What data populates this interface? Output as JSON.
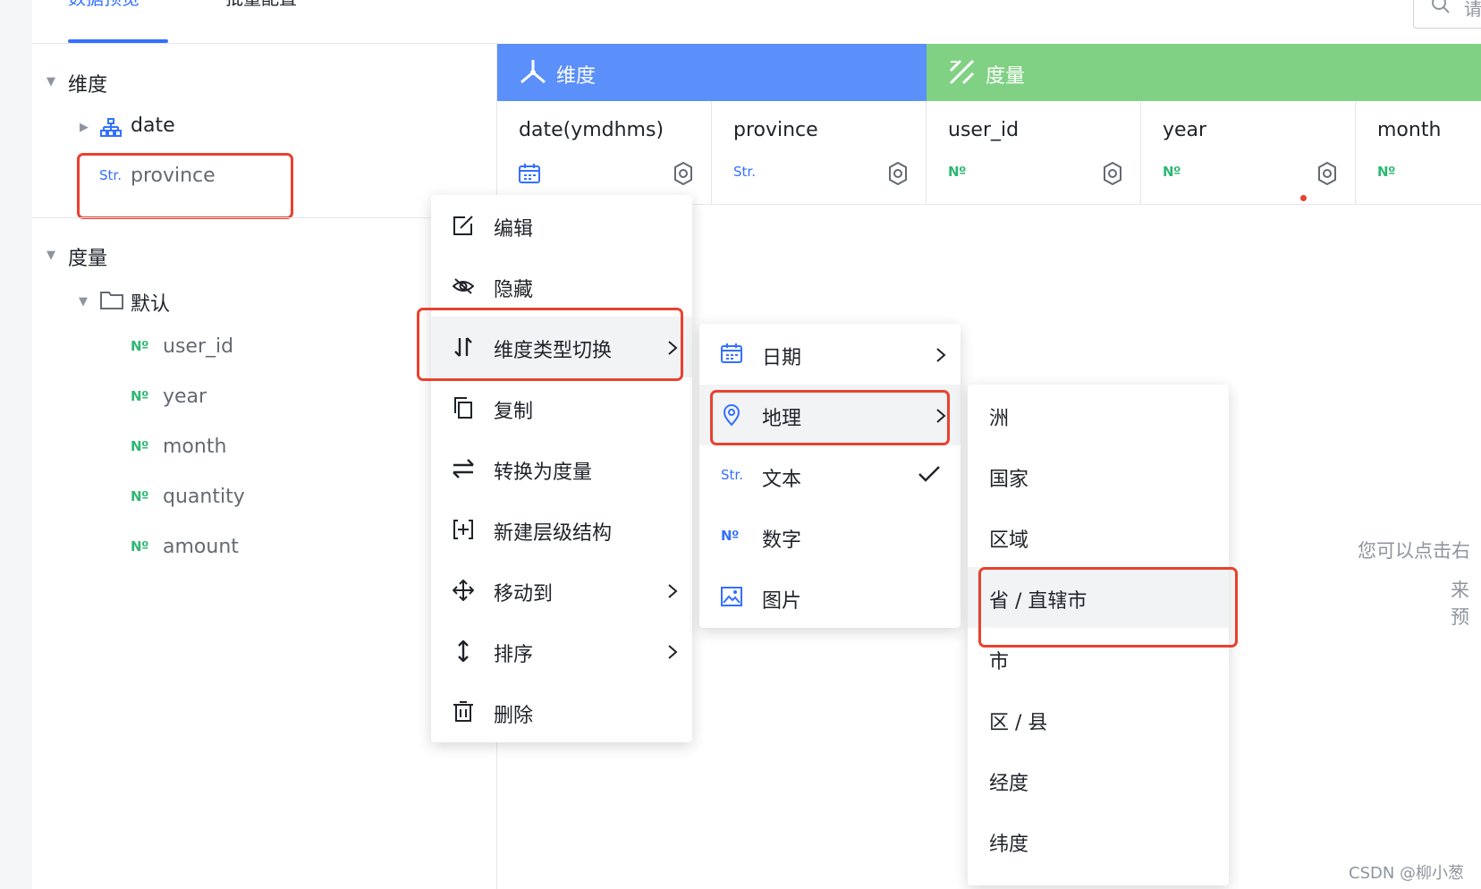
{
  "tabs": [
    {
      "label": "数据预览"
    },
    {
      "label": "批量配置"
    }
  ],
  "search": {
    "placeholder_visible": "请"
  },
  "tree": {
    "dimension_group": "维度",
    "dimension_fields": [
      {
        "label": "date",
        "type": "hierarchy"
      },
      {
        "label": "province",
        "badge": "Str."
      }
    ],
    "measure_group": "度量",
    "measure_folder": "默认",
    "measure_fields": [
      {
        "label": "user_id",
        "badge": "Nº"
      },
      {
        "label": "year",
        "badge": "Nº"
      },
      {
        "label": "month",
        "badge": "Nº"
      },
      {
        "label": "quantity",
        "badge": "Nº"
      },
      {
        "label": "amount",
        "badge": "Nº"
      }
    ]
  },
  "table": {
    "dimension_header": "维度",
    "measure_header": "度量",
    "columns": [
      {
        "name": "date(ymdhms)",
        "type": "calendar"
      },
      {
        "name": "province",
        "type_label": "Str."
      },
      {
        "name": "user_id",
        "type_label": "Nº"
      },
      {
        "name": "year",
        "type_label": "Nº"
      },
      {
        "name": "month",
        "type_label": "Nº"
      }
    ]
  },
  "context_menu": {
    "items": [
      {
        "label": "编辑",
        "icon": "edit-icon"
      },
      {
        "label": "隐藏",
        "icon": "eye-off-icon"
      },
      {
        "label": "维度类型切换",
        "icon": "swap-vertical-icon"
      },
      {
        "label": "复制",
        "icon": "copy-icon"
      },
      {
        "label": "转换为度量",
        "icon": "exchange-icon"
      },
      {
        "label": "新建层级结构",
        "icon": "hierarchy-add-icon"
      },
      {
        "label": "移动到",
        "icon": "move-icon"
      },
      {
        "label": "排序",
        "icon": "sort-icon"
      },
      {
        "label": "删除",
        "icon": "trash-icon"
      }
    ]
  },
  "type_menu": {
    "items": [
      {
        "label": "日期",
        "icon": "calendar-icon"
      },
      {
        "label": "地理",
        "icon": "location-icon"
      },
      {
        "label": "文本",
        "badge": "Str."
      },
      {
        "label": "数字",
        "badge": "Nº"
      },
      {
        "label": "图片",
        "icon": "image-icon"
      }
    ]
  },
  "geo_menu": {
    "items": [
      {
        "label": "洲"
      },
      {
        "label": "国家"
      },
      {
        "label": "区域"
      },
      {
        "label": "省 / 直辖市"
      },
      {
        "label": "市"
      },
      {
        "label": "区 / 县"
      },
      {
        "label": "经度"
      },
      {
        "label": "纬度"
      }
    ]
  },
  "hint": {
    "line1": "您可以点击右",
    "line2": "来预"
  },
  "watermark": "CSDN @柳小葱",
  "colors": {
    "accent": "#3370ff",
    "dimension_band": "#5b8ff9",
    "measure_band": "#80d184",
    "highlight": "#e8412f",
    "number_badge": "#2eb872"
  }
}
